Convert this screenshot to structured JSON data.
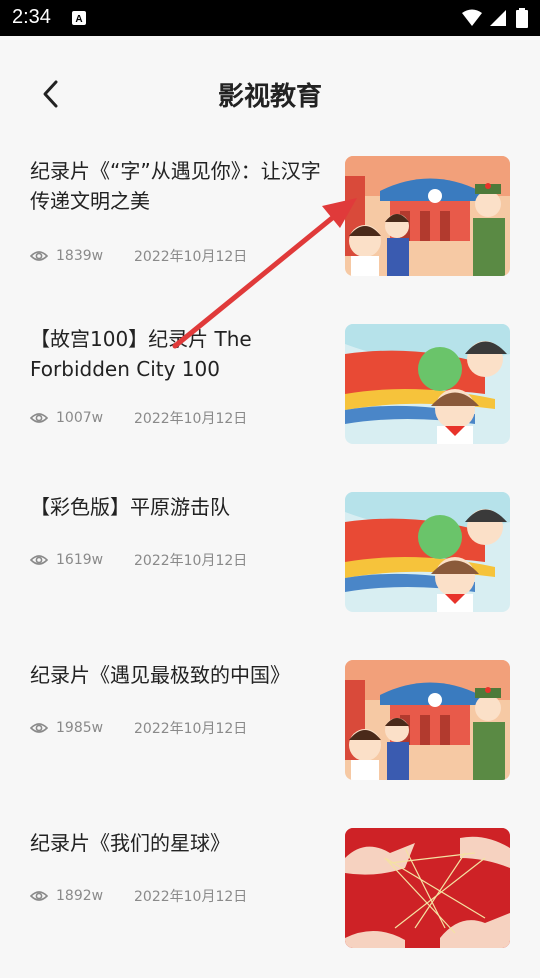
{
  "status": {
    "time": "2:34"
  },
  "header": {
    "title": "影视教育"
  },
  "items": [
    {
      "title": "纪录片《“字”从遇见你》：让汉字传递文明之美",
      "views": "1839w",
      "date": "2022年10月12日",
      "thumb": "parade-cartoon"
    },
    {
      "title": "【故宫100】纪录片 The Forbidden City 100",
      "views": "1007w",
      "date": "2022年10月12日",
      "thumb": "kids-cartoon"
    },
    {
      "title": "【彩色版】平原游击队",
      "views": "1619w",
      "date": "2022年10月12日",
      "thumb": "kids-cartoon"
    },
    {
      "title": "纪录片《遇见最极致的中国》",
      "views": "1985w",
      "date": "2022年10月12日",
      "thumb": "parade-cartoon"
    },
    {
      "title": "纪录片《我们的星球》",
      "views": "1892w",
      "date": "2022年10月12日",
      "thumb": "string-hands"
    }
  ],
  "colors": {
    "accent_arrow": "#e03a3a",
    "background": "#f7f7f7",
    "meta_text": "#8a8a8a"
  }
}
